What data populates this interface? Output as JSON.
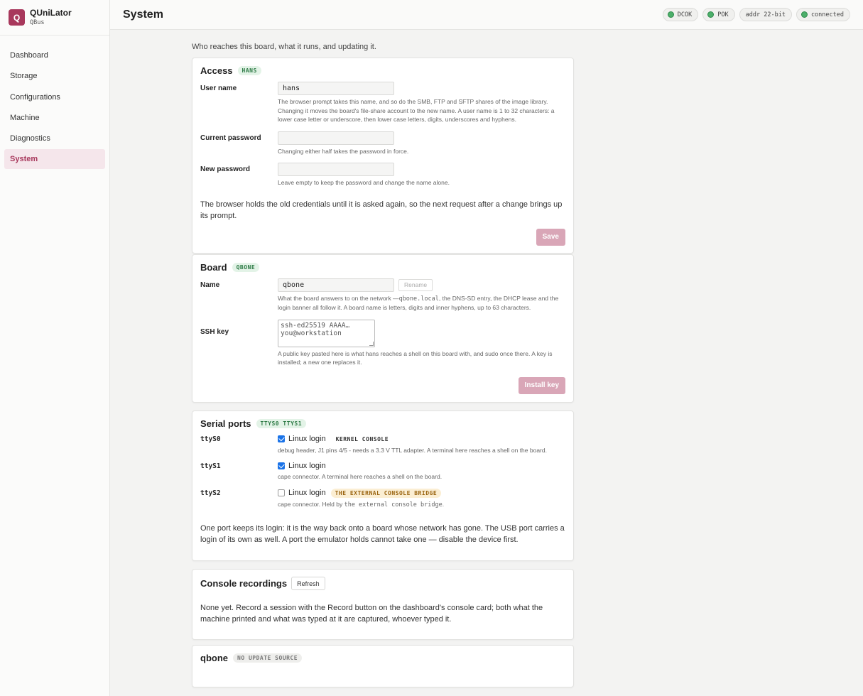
{
  "app": {
    "logo_letter": "Q",
    "name": "QUniLator",
    "sub": "QBus"
  },
  "nav": [
    {
      "label": "Dashboard"
    },
    {
      "label": "Storage"
    },
    {
      "label": "Configurations"
    },
    {
      "label": "Machine"
    },
    {
      "label": "Diagnostics"
    },
    {
      "label": "System",
      "active": true
    }
  ],
  "header": {
    "title": "System",
    "pills": [
      {
        "label": "DCOK",
        "dot": true
      },
      {
        "label": "POK",
        "dot": true
      },
      {
        "label": "addr 22-bit",
        "dot": false
      },
      {
        "label": "connected",
        "dot": true
      }
    ]
  },
  "intro": "Who reaches this board, what it runs, and updating it.",
  "access": {
    "title": "Access",
    "tag": "HANS",
    "username_label": "User name",
    "username_value": "hans",
    "username_help": "The browser prompt takes this name, and so do the SMB, FTP and SFTP shares of the image library. Changing it moves the board's file-share account to the new name. A user name is 1 to 32 characters: a lower case letter or underscore, then lower case letters, digits, underscores and hyphens.",
    "current_pw_label": "Current password",
    "current_pw_help": "Changing either half takes the password in force.",
    "new_pw_label": "New password",
    "new_pw_help": "Leave empty to keep the password and change the name alone.",
    "note": "The browser holds the old credentials until it is asked again, so the next request after a change brings up its prompt.",
    "save_label": "Save"
  },
  "board": {
    "title": "Board",
    "tag": "QBONE",
    "name_label": "Name",
    "name_value": "qbone",
    "rename_label": "Rename",
    "name_help_1": "What the board answers to on the network —",
    "name_help_mono": "qbone.local",
    "name_help_2": ", the DNS-SD entry, the DHCP lease and the login banner all follow it. A board name is letters, digits and inner hyphens, up to 63 characters.",
    "ssh_label": "SSH key",
    "ssh_placeholder_1": "ssh-ed25519 AAAA…",
    "ssh_placeholder_2": "you@workstation",
    "ssh_help": "A public key pasted here is what hans reaches a shell on this board with, and sudo once there. A key is installed; a new one replaces it.",
    "install_label": "Install key"
  },
  "serial": {
    "title": "Serial ports",
    "tag": "TTYS0 TTYS1",
    "ports": [
      {
        "name": "ttyS0",
        "checked": true,
        "check_label": "Linux login",
        "badge": "KERNEL CONSOLE",
        "help": "debug header, J1 pins 4/5 - needs a 3.3 V TTL adapter. A terminal here reaches a shell on the board."
      },
      {
        "name": "ttyS1",
        "checked": true,
        "check_label": "Linux login",
        "badge": "",
        "help": "cape connector. A terminal here reaches a shell on the board."
      },
      {
        "name": "ttyS2",
        "checked": false,
        "check_label": "Linux login",
        "badge": "THE EXTERNAL CONSOLE BRIDGE",
        "help_prefix": "cape connector. Held by",
        "help_mono": "the external console bridge",
        "help_suffix": "."
      }
    ],
    "note": "One port keeps its login: it is the way back onto a board whose network has gone. The USB port carries a login of its own as well. A port the emulator holds cannot take one — disable the device first."
  },
  "recordings": {
    "title": "Console recordings",
    "refresh_label": "Refresh",
    "note": "None yet. Record a session with the Record button on the dashboard's console card; both what the machine printed and what was typed at it are captured, whoever typed it."
  },
  "update": {
    "title": "qbone",
    "tag": "NO UPDATE SOURCE"
  },
  "colors": {
    "accent": "#a8385c",
    "accent_soft": "#f5e6eb",
    "ok": "#4caf6a"
  }
}
